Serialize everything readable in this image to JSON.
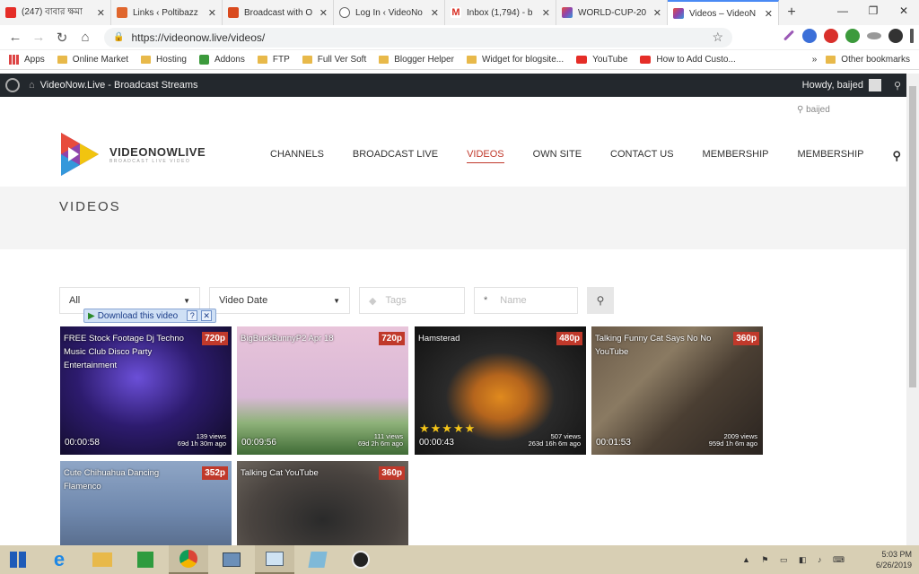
{
  "browser": {
    "tabs": [
      {
        "title": "(247) বাবার ক্ষমা",
        "icon": "youtube-icon",
        "color": "#e52d27"
      },
      {
        "title": "Links ‹ Poltibazz",
        "icon": "links-icon",
        "color": "#e0662d"
      },
      {
        "title": "Broadcast with O",
        "icon": "broadcast-icon",
        "color": "#d94a1e"
      },
      {
        "title": "Log In ‹ VideoNo",
        "icon": "globe-icon",
        "color": "#666666"
      },
      {
        "title": "Inbox (1,794) - b",
        "icon": "gmail-icon",
        "color": "#d93025"
      },
      {
        "title": "WORLD-CUP-20",
        "icon": "videonow-icon",
        "color": "#8e44ad"
      },
      {
        "title": "Videos – VideoN",
        "icon": "videonow-icon",
        "color": "#8e44ad",
        "active": true
      }
    ],
    "url": "https://videonow.live/videos/",
    "bookmarks": [
      "Apps",
      "Online Market",
      "Hosting",
      "Addons",
      "FTP",
      "Full Ver Soft",
      "Blogger Helper",
      "Widget for blogsite...",
      "YouTube",
      "How to Add Custo...",
      "»",
      "Other bookmarks"
    ]
  },
  "wpbar": {
    "site": "VideoNow.Live - Broadcast Streams",
    "howdy": "Howdy, baijed"
  },
  "site": {
    "user": "baijed",
    "logo_title": "VIDEONOWLIVE",
    "logo_sub": "BROADCAST LIVE VIDEO",
    "nav": [
      "CHANNELS",
      "BROADCAST LIVE",
      "VIDEOS",
      "OWN SITE",
      "CONTACT US",
      "MEMBERSHIP",
      "MEMBERSHIP"
    ],
    "active_nav": "VIDEOS",
    "page_title": "VIDEOS",
    "filters": {
      "category": "All",
      "sort": "Video Date",
      "tags_placeholder": "Tags",
      "name_placeholder": "Name"
    },
    "download_label": "Download this video"
  },
  "videos": [
    {
      "title": "FREE Stock Footage Dj Techno Music Club Disco Party Entertainment",
      "quality": "720p",
      "duration": "00:00:58",
      "views": "139 views",
      "ago": "69d 1h 30m ago",
      "rating": ""
    },
    {
      "title": "BigBuckBunnyP2 Apr 18",
      "quality": "720p",
      "duration": "00:09:56",
      "views": "111 views",
      "ago": "69d 2h 6m ago",
      "rating": ""
    },
    {
      "title": "Hamsterad",
      "quality": "480p",
      "duration": "00:00:43",
      "views": "507 views",
      "ago": "263d 16h 6m ago",
      "rating": "★★★★★"
    },
    {
      "title": "Talking Funny Cat Says No No YouTube",
      "quality": "360p",
      "duration": "00:01:53",
      "views": "2009 views",
      "ago": "959d 1h 6m ago",
      "rating": ""
    },
    {
      "title": "Cute Chihuahua Dancing Flamenco",
      "quality": "352p",
      "duration": "",
      "views": "",
      "ago": "",
      "rating": ""
    },
    {
      "title": "Talking Cat YouTube",
      "quality": "360p",
      "duration": "",
      "views": "",
      "ago": "",
      "rating": ""
    }
  ],
  "taskbar": {
    "time": "5:03 PM",
    "date": "6/26/2019"
  }
}
